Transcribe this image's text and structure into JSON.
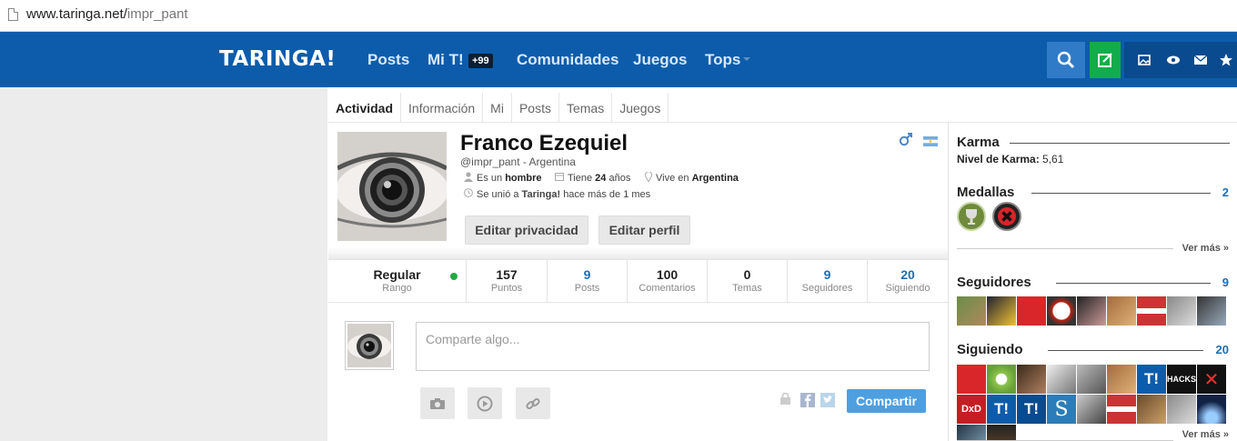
{
  "browser": {
    "url_host": "www.taringa.net/",
    "url_path": "impr_pant"
  },
  "nav": {
    "logo": "TARINGA!",
    "items": [
      "Posts",
      "Mi T!",
      "Comunidades",
      "Juegos",
      "Tops"
    ],
    "badge": "+99",
    "colors": {
      "bar": "#0d5cab",
      "search": "#2f7bc8",
      "new_post": "#12ac4c",
      "tools": "#0a4a8e"
    }
  },
  "tabs": [
    "Actividad",
    "Información",
    "Mi",
    "Posts",
    "Temas",
    "Juegos"
  ],
  "profile": {
    "name": "Franco Ezequiel",
    "handle": "@impr_pant - Argentina",
    "gender_prefix": "Es un",
    "gender": "hombre",
    "age_prefix": "Tiene",
    "age": "24",
    "age_suffix": "años",
    "lives_prefix": "Vive en",
    "lives": "Argentina",
    "joined_prefix": "Se unió a",
    "joined_site": "Taringa!",
    "joined_suffix": "hace más de 1 mes",
    "btn_privacy": "Editar privacidad",
    "btn_edit": "Editar perfil"
  },
  "stats": {
    "rank": {
      "value": "Regular",
      "label": "Rango"
    },
    "items": [
      {
        "value": "157",
        "label": "Puntos"
      },
      {
        "value": "9",
        "label": "Posts"
      },
      {
        "value": "100",
        "label": "Comentarios"
      },
      {
        "value": "0",
        "label": "Temas"
      },
      {
        "value": "9",
        "label": "Seguidores"
      },
      {
        "value": "20",
        "label": "Siguiendo"
      }
    ]
  },
  "compose": {
    "placeholder": "Comparte algo...",
    "share_label": "Compartir"
  },
  "sidebar": {
    "karma": {
      "title": "Karma",
      "level_label": "Nivel de Karma:",
      "level_value": "5,61"
    },
    "medals": {
      "title": "Medallas",
      "count": "2",
      "more": "Ver más »"
    },
    "followers": {
      "title": "Seguidores",
      "count": "9"
    },
    "following": {
      "title": "Siguiendo",
      "count": "20",
      "more": "Ver más »"
    }
  }
}
